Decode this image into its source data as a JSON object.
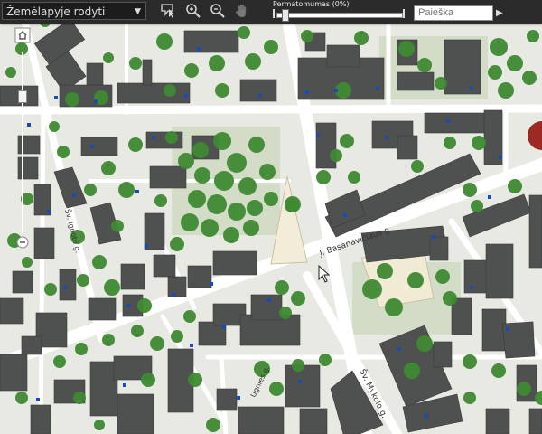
{
  "toolbar": {
    "layer_select": "Žemėlapyje rodyti",
    "transparency_label": "Permatomumas (0%)",
    "transparency_value_percent": 0,
    "search_placeholder": "Paieška"
  },
  "tools": [
    "info-pointer-icon",
    "zoom-in-icon",
    "zoom-out-icon",
    "pan-hand-icon"
  ],
  "map": {
    "streets": [
      {
        "name": "J. Basanavičiaus g."
      },
      {
        "name": "Šv. Ignoto g."
      },
      {
        "name": "Šv. Mykolo g."
      },
      {
        "name": "Ugnies g."
      }
    ],
    "colors": {
      "background": "#e9ebe4",
      "road": "#ffffff",
      "building": "#4d4d4d",
      "tree": "#3f8a32",
      "label": "#1a4bb5"
    }
  }
}
